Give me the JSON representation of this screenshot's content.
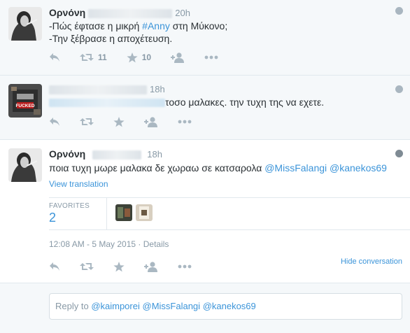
{
  "tweets": [
    {
      "name": "Ορνόνη",
      "time": "20h",
      "lines": [
        "-Πώς έφτασε η μικρή ",
        "#Anny",
        " στη Μύκονο;",
        "-Την ξέβρασε η αποχέτευση."
      ],
      "retweets": "11",
      "favorites": "10"
    },
    {
      "time": "18h",
      "text": "τοσο μαλακες. την τυχη της να εχετε.",
      "avatar_text": "FUCKED"
    },
    {
      "name": "Ορνόνη",
      "time": "18h",
      "text_plain": "ποια τυχη μωρε μαλακα δε χωραω σε κατσαρολα ",
      "mention1": "@MissFalangi",
      "mention2": "@kanekos69",
      "translate": "View translation",
      "favorites_label": "FAVORITES",
      "favorites_count": "2",
      "timestamp": "12:08 AM - 5 May 2015 · Details",
      "hide_conversation": "Hide conversation"
    }
  ],
  "reply": {
    "prefix": "Reply to ",
    "m1": "@kaimporei",
    "m2": "@MissFalangi",
    "m3": "@kanekos69"
  },
  "colors": {
    "link": "#3b94d9",
    "muted": "#8899a6",
    "icon": "#aab8c2",
    "bg": "#f5f8fa"
  },
  "icons": [
    "reply-icon",
    "retweet-icon",
    "favorite-star-icon",
    "follow-user-icon",
    "more-dots-icon",
    "globe-icon"
  ]
}
